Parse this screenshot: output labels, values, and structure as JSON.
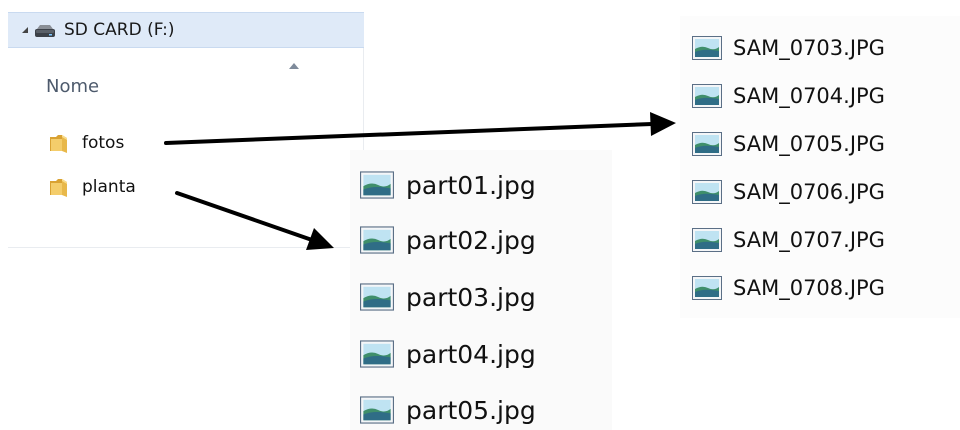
{
  "tree": {
    "drive_label": "SD CARD (F:)",
    "column_header": "Nome",
    "folders": [
      {
        "label": "fotos",
        "icon": "folder-icon"
      },
      {
        "label": "planta",
        "icon": "folder-icon"
      }
    ]
  },
  "fotos_files": [
    "SAM_0703.JPG",
    "SAM_0704.JPG",
    "SAM_0705.JPG",
    "SAM_0706.JPG",
    "SAM_0707.JPG",
    "SAM_0708.JPG"
  ],
  "planta_files": [
    "part01.jpg",
    "part02.jpg",
    "part03.jpg",
    "part04.jpg",
    "part05.jpg"
  ],
  "icons": {
    "drive": "sd-card-drive-icon",
    "folder": "folder-icon",
    "image_file": "image-file-icon",
    "arrow": "arrow-right-icon"
  },
  "colors": {
    "selection_bg": "#dfeaf8",
    "header_text": "#4d5a6c",
    "arrow": "#000000",
    "folder": "#e8b84a"
  }
}
